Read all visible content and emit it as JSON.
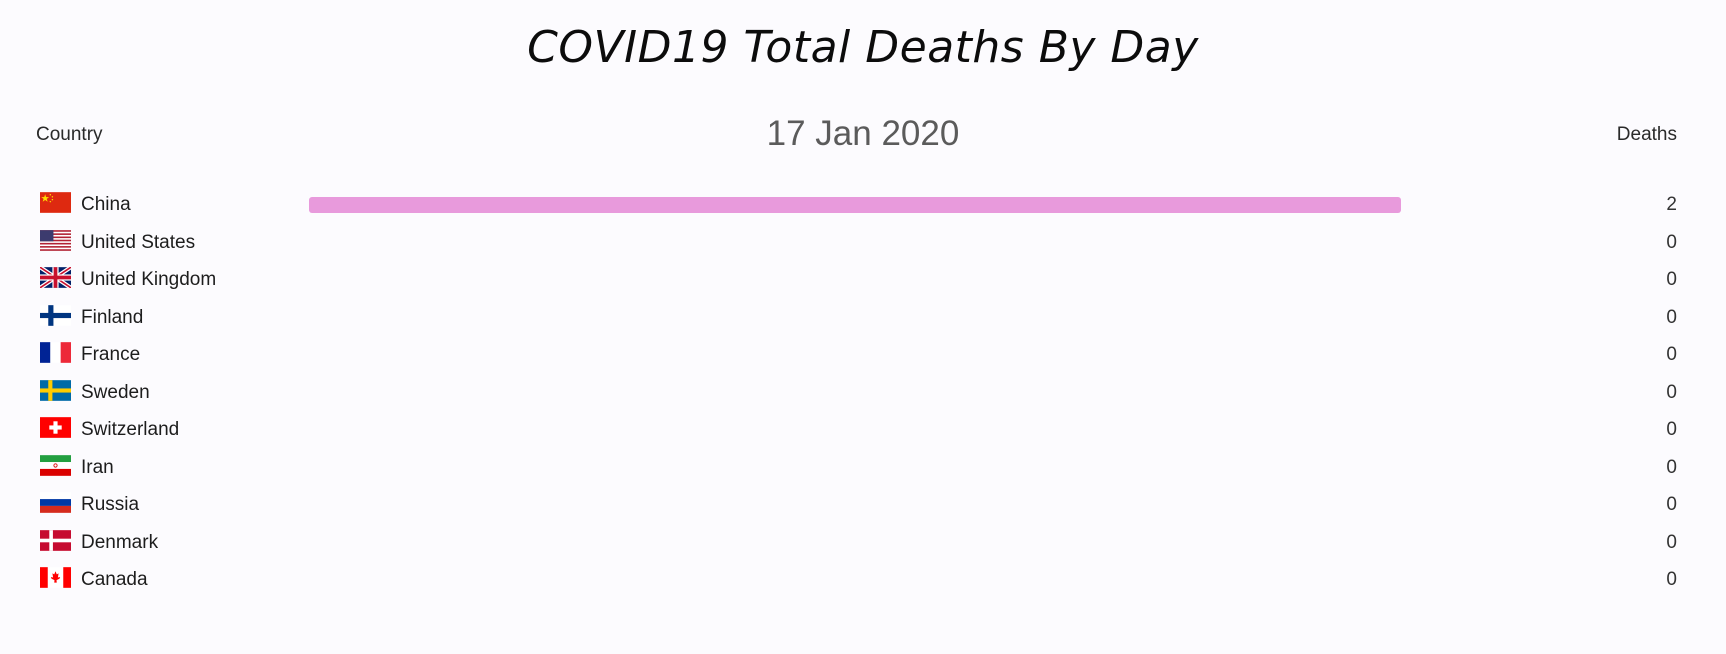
{
  "chart_data": {
    "type": "bar",
    "title": "COVID19 Total Deaths By Day",
    "date": "17 Jan 2020",
    "column_headers": {
      "left": "Country",
      "right": "Deaths"
    },
    "categories": [
      "China",
      "United States",
      "United Kingdom",
      "Finland",
      "France",
      "Sweden",
      "Switzerland",
      "Iran",
      "Russia",
      "Denmark",
      "Canada"
    ],
    "values": [
      2,
      0,
      0,
      0,
      0,
      0,
      0,
      0,
      0,
      0,
      0
    ],
    "flags": [
      "china-flag-icon",
      "united-states-flag-icon",
      "united-kingdom-flag-icon",
      "finland-flag-icon",
      "france-flag-icon",
      "sweden-flag-icon",
      "switzerland-flag-icon",
      "iran-flag-icon",
      "russia-flag-icon",
      "denmark-flag-icon",
      "canada-flag-icon"
    ],
    "bar_color": "#e89adc",
    "xlim": [
      0,
      2
    ]
  }
}
